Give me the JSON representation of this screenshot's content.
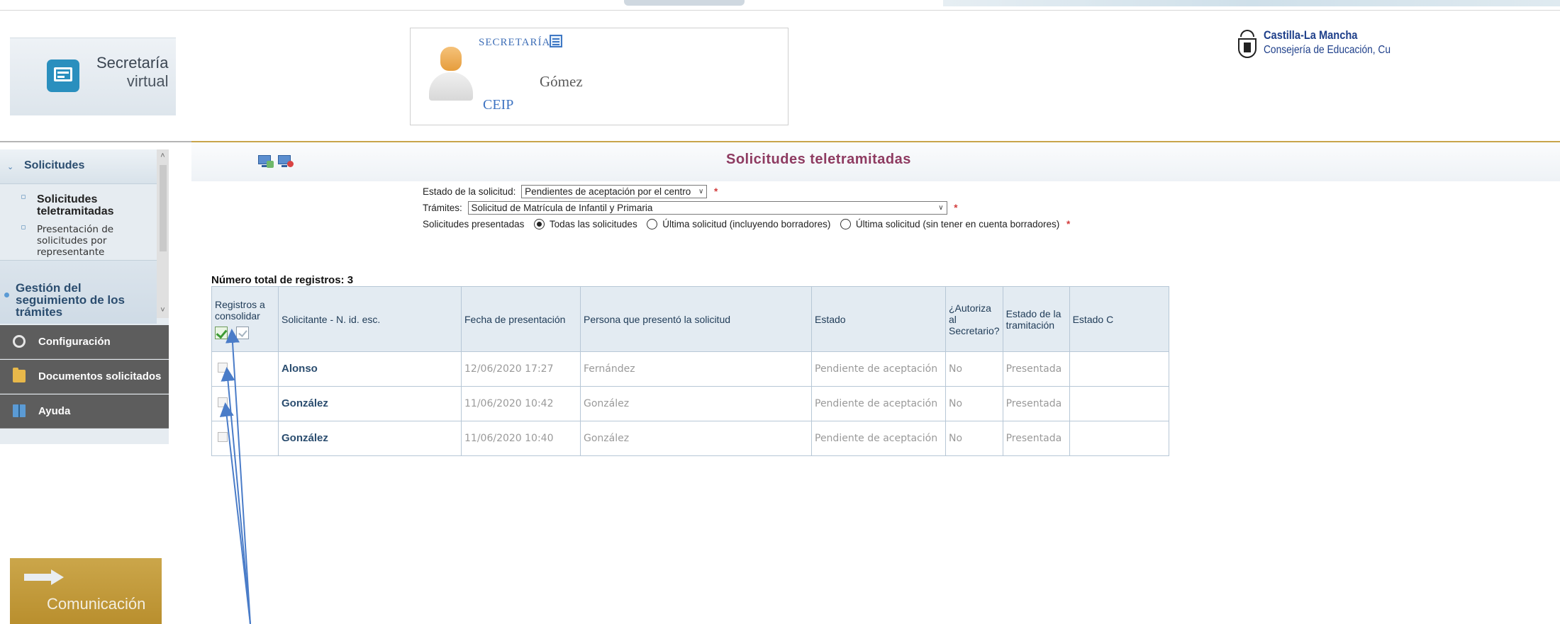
{
  "header": {
    "logo": {
      "line1": "Secretaría",
      "line2": "virtual"
    },
    "user": {
      "role": "SECRETARÍA",
      "name": "Gómez",
      "center": "CEIP"
    },
    "brand": {
      "title": "Castilla-La Mancha",
      "subtitle": "Consejería de Educación, Cu"
    }
  },
  "sidebar": {
    "section": "Solicitudes",
    "items": [
      {
        "label": "Solicitudes teletramitadas",
        "active": true
      },
      {
        "label": "Presentación de solicitudes por representante",
        "active": false
      }
    ],
    "gestion": "Gestión del seguimiento de los trámites",
    "config": "Configuración",
    "docs": "Documentos solicitados",
    "ayuda": "Ayuda",
    "comunicacion": "Comunicación"
  },
  "main": {
    "title": "Solicitudes teletramitadas",
    "filters": {
      "estado_label": "Estado de la solicitud:",
      "estado_value": "Pendientes de aceptación por el centro",
      "tramites_label": "Trámites:",
      "tramites_value": "Solicitud de Matrícula de Infantil y Primaria",
      "presentadas_label": "Solicitudes presentadas",
      "opt1": "Todas las solicitudes",
      "opt2": "Última solicitud (incluyendo borradores)",
      "opt3": "Última solicitud (sin tener en cuenta borradores)",
      "required": "*"
    },
    "total": "Número total de registros: 3",
    "columns": {
      "registros": "Registros a consolidar",
      "solicitante": "Solicitante - N. id. esc.",
      "fecha": "Fecha de presentación",
      "persona": "Persona que presentó la solicitud",
      "estado": "Estado",
      "autoriza": "¿Autoriza al Secretario?",
      "estado_tramitacion": "Estado de la tramitación",
      "estado_extra": "Estado C"
    },
    "rows": [
      {
        "solicitante": "Alonso",
        "fecha": "12/06/2020 17:27",
        "persona": "Fernández",
        "estado": "Pendiente de aceptación",
        "autoriza": "No",
        "tramitacion": "Presentada"
      },
      {
        "solicitante": "González",
        "fecha": "11/06/2020 10:42",
        "persona": "González",
        "estado": "Pendiente de aceptación",
        "autoriza": "No",
        "tramitacion": "Presentada"
      },
      {
        "solicitante": "González",
        "fecha": "11/06/2020 10:40",
        "persona": "González",
        "estado": "Pendiente de aceptación",
        "autoriza": "No",
        "tramitacion": "Presentada"
      }
    ]
  },
  "colors": {
    "accent_title": "#8e3b61",
    "gold_bar": "#c8a44a",
    "nav_dark": "#5d5d5d",
    "header_bg": "#e3ebf2"
  },
  "icons": [
    "secretaria-logo-icon",
    "user-avatar-icon",
    "document-icon",
    "coat-of-arms-icon",
    "monitor-icon",
    "monitor-remove-icon",
    "gear-icon",
    "folder-icon",
    "book-icon",
    "arrow-icon"
  ]
}
